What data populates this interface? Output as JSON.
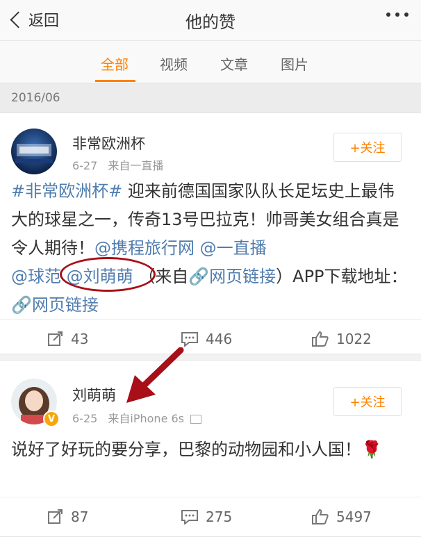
{
  "navbar": {
    "back_label": "返回",
    "title": "他的赞"
  },
  "tabs": [
    "全部",
    "视频",
    "文章",
    "图片"
  ],
  "date_header": "2016/06",
  "posts": [
    {
      "username": "非常欧洲杯",
      "date": "6-27",
      "source": "来自一直播",
      "follow_label": "+关注",
      "text": {
        "hashtag": "#非常欧洲杯#",
        "body1": " 迎来前德国国家队队长足坛史上最伟大的球星之一，传奇13号巴拉克！帅哥美女组合真是令人期待！",
        "mention1": "@携程旅行网",
        "mention2": " @一直播",
        "mention3": "@球范",
        "mention4": " @刘萌萌",
        "body2": " （来自",
        "link1": "网页链接",
        "body3": "）APP下载地址：",
        "link2": "网页链接"
      },
      "reposts": "43",
      "comments": "446",
      "likes": "1022"
    },
    {
      "username": "刘萌萌",
      "date": "6-25",
      "source": "来自iPhone 6s",
      "follow_label": "+关注",
      "text": {
        "body": "说好了好玩的要分享，巴黎的动物园和小人国！",
        "emoji": "🌹"
      },
      "reposts": "87",
      "comments": "275",
      "likes": "5497"
    }
  ],
  "colors": {
    "accent": "#ff8200",
    "link": "#507daf",
    "annotation": "#a80f18"
  }
}
